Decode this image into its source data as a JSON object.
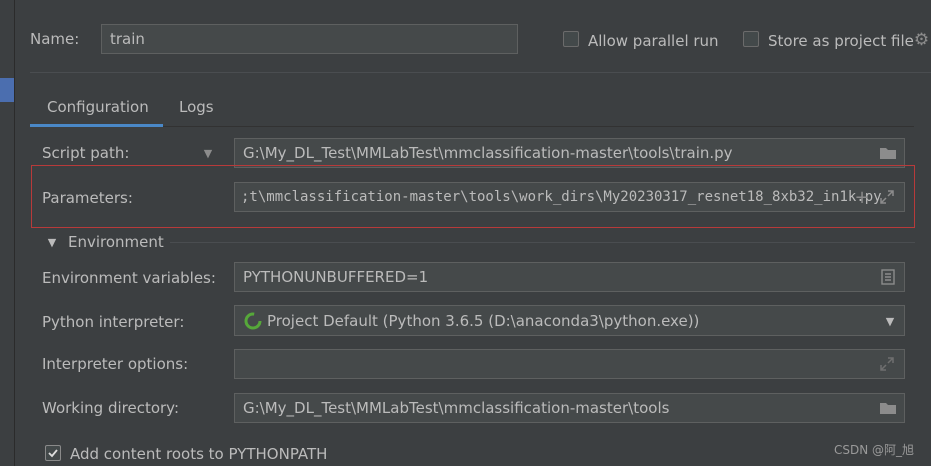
{
  "name_label": "Name:",
  "name_value": "train",
  "allow_parallel_label": "Allow parallel run",
  "store_project_label": "Store as project file",
  "tabs": [
    {
      "label": "Configuration"
    },
    {
      "label": "Logs"
    }
  ],
  "script_path": {
    "label": "Script path:",
    "value": "G:\\My_DL_Test\\MMLabTest\\mmclassification-master\\tools\\train.py"
  },
  "parameters": {
    "label": "Parameters:",
    "value": ";t\\mmclassification-master\\tools\\work_dirs\\My20230317_resnet18_8xb32_in1k.py"
  },
  "environment_title": "Environment",
  "env_vars": {
    "label": "Environment variables:",
    "value": "PYTHONUNBUFFERED=1"
  },
  "interpreter": {
    "label": "Python interpreter:",
    "value": "Project Default (Python 3.6.5 (D:\\anaconda3\\python.exe))"
  },
  "interpreter_options": {
    "label": "Interpreter options:",
    "value": ""
  },
  "working_dir": {
    "label": "Working directory:",
    "value": "G:\\My_DL_Test\\MMLabTest\\mmclassification-master\\tools"
  },
  "add_content_roots_label": "Add content roots to PYTHONPATH",
  "watermark": "CSDN @阿_旭",
  "colors": {
    "background": "#3c3f41",
    "field": "#45494a",
    "accent_tab": "#4a88c7",
    "highlight_box": "#b83a3a",
    "interpreter_ring": "#56a83a"
  }
}
